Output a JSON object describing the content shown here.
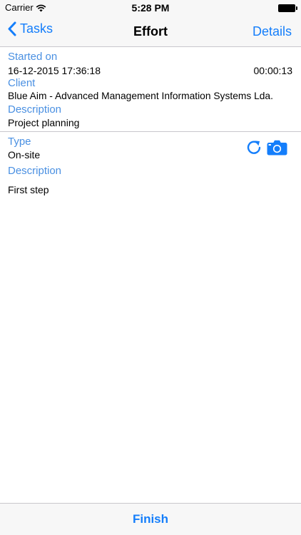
{
  "status_bar": {
    "carrier": "Carrier",
    "time": "5:28 PM",
    "icons": [
      "wifi-icon",
      "battery-icon"
    ]
  },
  "nav": {
    "back_label": "Tasks",
    "title": "Effort",
    "details_label": "Details"
  },
  "effort": {
    "started_on_label": "Started on",
    "started_on_value": "16-12-2015 17:36:18",
    "elapsed": "00:00:13",
    "client_label": "Client",
    "client_value": "Blue Aim - Advanced Management Information Systems Lda.",
    "description_label": "Description",
    "description_value": "Project planning"
  },
  "activity": {
    "type_label": "Type",
    "type_value": "On-site",
    "description_label": "Description",
    "description_value": "First step",
    "icons": [
      "refresh-icon",
      "camera-icon"
    ]
  },
  "toolbar": {
    "finish_label": "Finish"
  },
  "colors": {
    "accent": "#147efb",
    "label": "#4a90e2",
    "bar_background": "#f7f7f7",
    "separator": "#c8c7cc"
  }
}
